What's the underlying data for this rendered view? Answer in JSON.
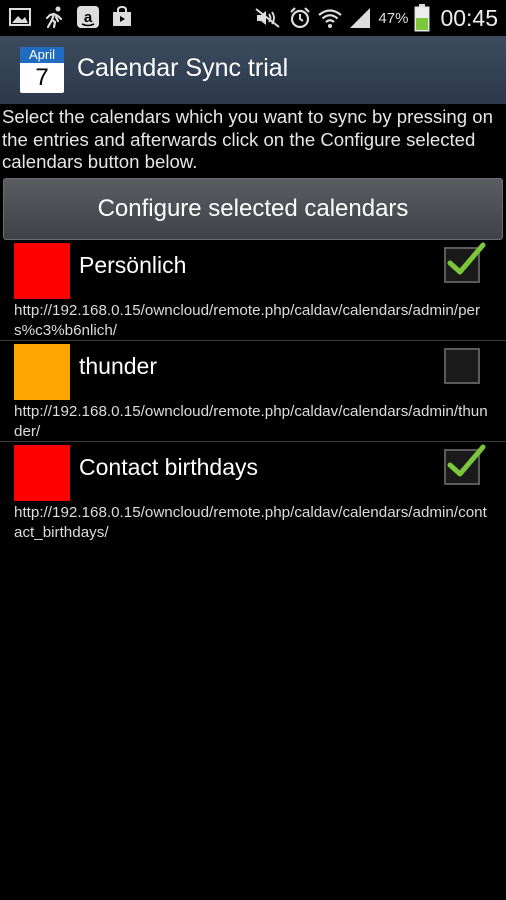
{
  "status_bar": {
    "icons_left": [
      "gallery-icon",
      "runner-icon",
      "amazon-icon",
      "store-bag-icon"
    ],
    "icons_right": [
      "mute-icon",
      "alarm-icon",
      "wifi-icon",
      "signal-icon",
      "battery-icon"
    ],
    "battery_percent": "47%",
    "time": "00:45"
  },
  "app": {
    "icon_month": "April",
    "icon_day": "7",
    "title": "Calendar Sync trial"
  },
  "instructions": "Select the calendars which you want to sync by pressing on the entries and afterwards click on the Configure selected calendars button below.",
  "configure_button_label": "Configure selected calendars",
  "calendars": [
    {
      "name": "Persönlich",
      "color": "#ff0000",
      "checked": true,
      "url": "http://192.168.0.15/owncloud/remote.php/caldav/calendars/admin/pers%c3%b6nlich/"
    },
    {
      "name": "thunder",
      "color": "#ffa500",
      "checked": false,
      "url": "http://192.168.0.15/owncloud/remote.php/caldav/calendars/admin/thunder/"
    },
    {
      "name": "Contact birthdays",
      "color": "#ff0000",
      "checked": true,
      "url": "http://192.168.0.15/owncloud/remote.php/caldav/calendars/admin/contact_birthdays/"
    }
  ],
  "colors": {
    "titlebar": "#354357",
    "checkmark": "#7cc63b"
  }
}
